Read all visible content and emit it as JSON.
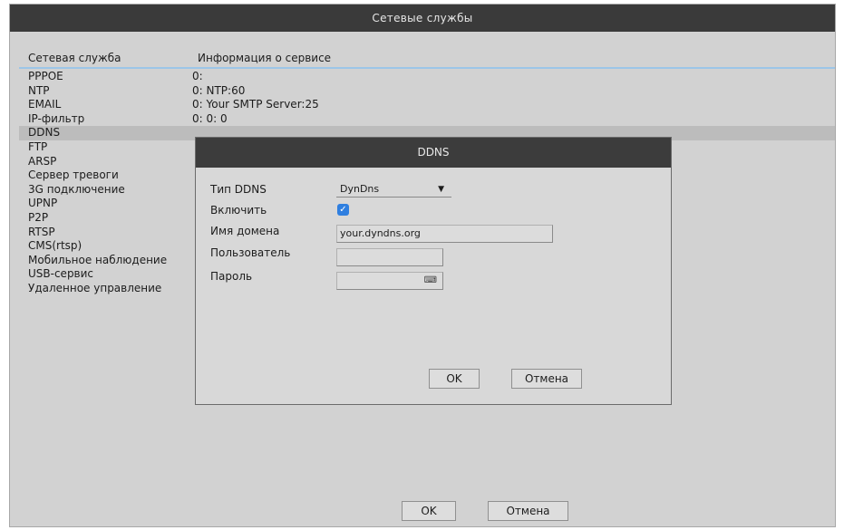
{
  "window": {
    "title": "Сетевые службы"
  },
  "list": {
    "headers": {
      "name": "Сетевая служба",
      "info": "Информация о сервисе"
    },
    "rows": [
      {
        "name": "PPPOE",
        "info": "0:"
      },
      {
        "name": "NTP",
        "info": "0: NTP:60"
      },
      {
        "name": "EMAIL",
        "info": "0: Your SMTP Server:25"
      },
      {
        "name": "IP-фильтр",
        "info": "0: 0: 0"
      },
      {
        "name": "DDNS",
        "info": ""
      },
      {
        "name": "FTP",
        "info": ""
      },
      {
        "name": "ARSP",
        "info": ""
      },
      {
        "name": "Сервер тревоги",
        "info": ""
      },
      {
        "name": "3G подключение",
        "info": ""
      },
      {
        "name": "UPNP",
        "info": ""
      },
      {
        "name": "P2P",
        "info": ""
      },
      {
        "name": "RTSP",
        "info": ""
      },
      {
        "name": "CMS(rtsp)",
        "info": ""
      },
      {
        "name": "Мобильное наблюдение",
        "info": ""
      },
      {
        "name": "USB-сервис",
        "info": ""
      },
      {
        "name": "Удаленное управление",
        "info": ""
      }
    ],
    "selected_index": 4
  },
  "dialog": {
    "title": "DDNS",
    "labels": {
      "type": "Тип DDNS",
      "enable": "Включить",
      "domain": "Имя домена",
      "user": "Пользователь",
      "password": "Пароль"
    },
    "type_value": "DynDns",
    "enabled": true,
    "domain_value": "your.dyndns.org",
    "user_value": "",
    "password_value": "",
    "ok_label": "OK",
    "cancel_label": "Отмена"
  },
  "footer": {
    "ok_label": "OK",
    "cancel_label": "Отмена"
  },
  "colors": {
    "titlebar": "#3a3a3a",
    "checkbox": "#2f7fe0",
    "header_rule": "#9cc6e8"
  }
}
